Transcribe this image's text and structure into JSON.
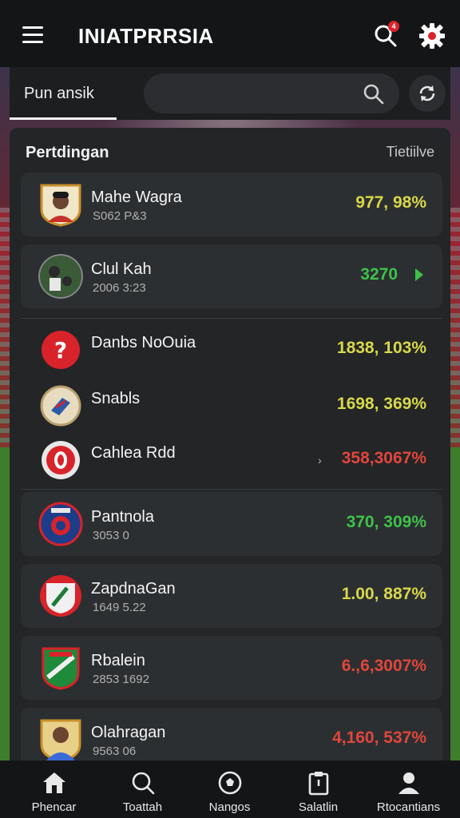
{
  "app": {
    "title": "INIATPRRSIA",
    "notification_badge": "4"
  },
  "tabs": {
    "active_label": "Pun ansik"
  },
  "search": {
    "placeholder": ""
  },
  "panel": {
    "title": "Pertdingan",
    "action_label": "Tietiilve"
  },
  "rows": [
    {
      "name": "Mahe Wagra",
      "sub": "S062 P&3",
      "value": "977, 98%",
      "value_color": "#d8d84a"
    },
    {
      "name": "Clul Kah",
      "sub": "2006 3:23",
      "value": "3270",
      "value_color": "#3ec24a"
    },
    {
      "name": "Danbs NoOuia",
      "sub": "",
      "value": "1838, 103%",
      "value_color": "#d8d84a"
    },
    {
      "name": "Snabls",
      "sub": "",
      "value": "1698, 369%",
      "value_color": "#d8d84a"
    },
    {
      "name": "Cahlea Rdd",
      "sub": "",
      "value": "358,3067%",
      "value_color": "#e0463c"
    },
    {
      "name": "Pantnola",
      "sub": "3053 0",
      "value": "370, 309%",
      "value_color": "#3ec24a"
    },
    {
      "name": "ZapdnaGan",
      "sub": "1649 5.22",
      "value": "1.00,  887%",
      "value_color": "#d8d84a"
    },
    {
      "name": "Rbalein",
      "sub": "2853 1692",
      "value": "6.,6,3007%",
      "value_color": "#e0463c"
    },
    {
      "name": "Olahragan",
      "sub": "9563 06",
      "value": "4,160, 537%",
      "value_color": "#e0463c"
    }
  ],
  "bottom_nav": [
    {
      "label": "Phencar",
      "icon": "home-icon"
    },
    {
      "label": "Toattah",
      "icon": "search-icon"
    },
    {
      "label": "Nangos",
      "icon": "ball-icon"
    },
    {
      "label": "Salatlin",
      "icon": "clipboard-icon"
    },
    {
      "label": "Rtocantians",
      "icon": "profile-icon"
    }
  ],
  "colors": {
    "positive": "#3ec24a",
    "neutral": "#d8d84a",
    "negative": "#e0463c",
    "badge": "#d8232a"
  }
}
